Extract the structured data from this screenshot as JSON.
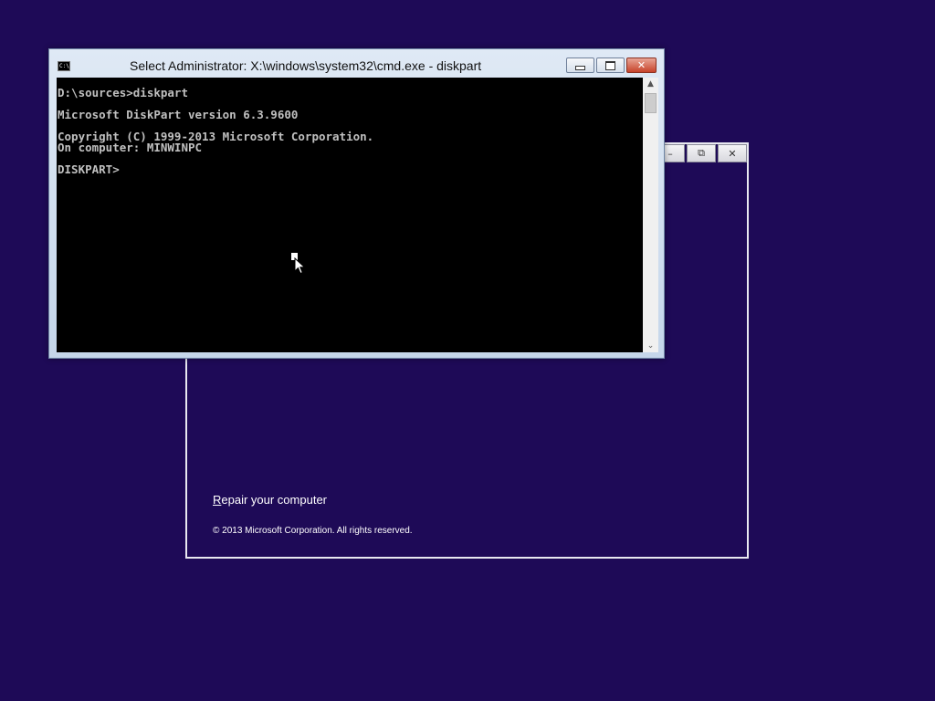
{
  "background_color": "#1e0a57",
  "setup_window": {
    "buttons": {
      "minimize": "–",
      "restore": "⧉",
      "close": "✕"
    },
    "repair_link": {
      "accelerator": "R",
      "rest": "epair your computer"
    },
    "copyright": "© 2013 Microsoft Corporation. All rights reserved."
  },
  "cmd_window": {
    "title": "Select Administrator: X:\\windows\\system32\\cmd.exe - diskpart",
    "icon_label": "C:\\",
    "close_glyph": "✕",
    "console_lines": [
      "D:\\sources>diskpart",
      "",
      "Microsoft DiskPart version 6.3.9600",
      "",
      "Copyright (C) 1999-2013 Microsoft Corporation.",
      "On computer: MINWINPC",
      "",
      "DISKPART>"
    ],
    "scroll_up": "▲",
    "scroll_down": "⌄"
  }
}
